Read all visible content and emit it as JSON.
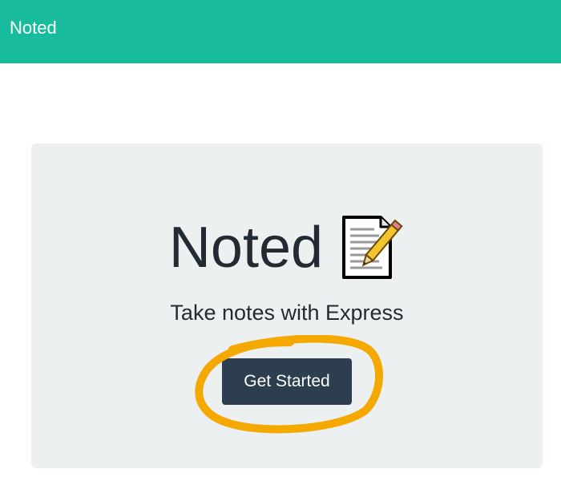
{
  "navbar": {
    "brand": "Noted",
    "background": "#18bc9c"
  },
  "hero": {
    "title": "Noted",
    "icon": "memo-icon",
    "tagline": "Take notes with Express",
    "cta_label": "Get Started",
    "cta_color": "#2c3e50",
    "panel_color": "#ecf0f1"
  },
  "annotation": {
    "type": "circled-highlight",
    "color": "#f5a800"
  }
}
